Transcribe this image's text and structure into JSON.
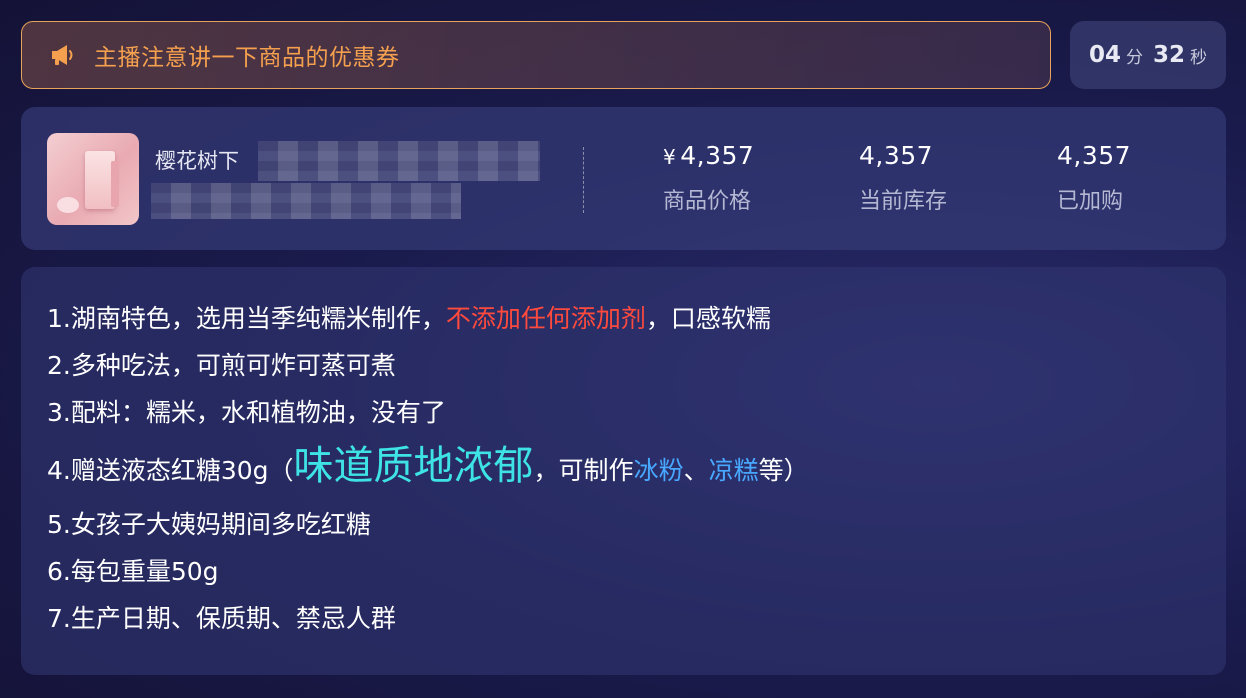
{
  "notice": {
    "text": "主播注意讲一下商品的优惠券",
    "icon": "megaphone-icon",
    "accent_color": "#f5a04e"
  },
  "timer": {
    "minutes": "04",
    "minutes_unit": "分",
    "seconds": "32",
    "seconds_unit": "秒"
  },
  "product": {
    "title": "樱花树下",
    "image": "product-thumbnail",
    "stats": {
      "price": {
        "currency": "¥",
        "value": "4,357",
        "label": "商品价格"
      },
      "stock": {
        "value": "4,357",
        "label": "当前库存"
      },
      "cart": {
        "value": "4,357",
        "label": "已加购"
      }
    }
  },
  "description": {
    "line1": {
      "before": "1.湖南特色，选用当季纯糯米制作，",
      "highlight": "不添加任何添加剂",
      "after": "，口感软糯",
      "highlight_color": "#ff4a3d"
    },
    "line2": "2.多种吃法，可煎可炸可蒸可煮",
    "line3": "3.配料：糯米，水和植物油，没有了",
    "line4": {
      "prefix": "4.赠送液态红糖30g（",
      "big": "味道质地浓郁",
      "mid": "，可制作",
      "blue1": "冰粉",
      "sep": "、",
      "blue2": "凉糕",
      "suffix": "等）",
      "big_color": "#3ee3e6",
      "blue_color": "#48a8ff"
    },
    "line5": "5.女孩子大姨妈期间多吃红糖",
    "line6": "6.每包重量50g",
    "line7": "7.生产日期、保质期、禁忌人群"
  }
}
